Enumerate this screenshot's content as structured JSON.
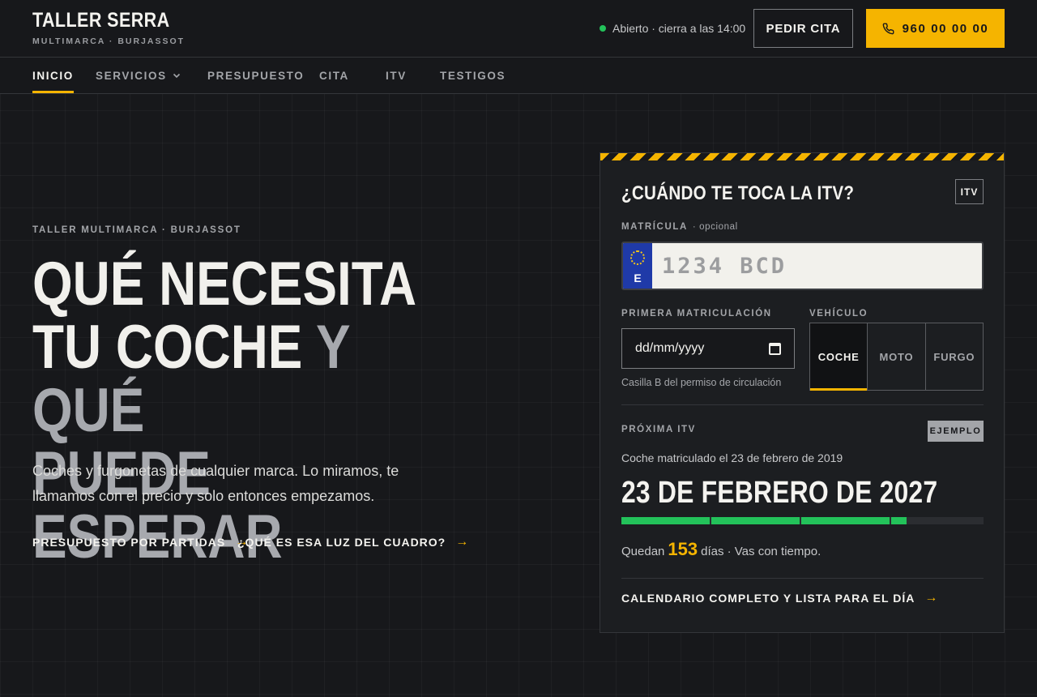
{
  "header": {
    "brand_title": "TALLER SERRA",
    "brand_subtitle": "MULTIMARCA · BURJASSOT",
    "status_text": "Abierto · cierra a las 14:00",
    "status_color": "#23c25a",
    "cita_button": "PEDIR CITA",
    "phone_button": "960 00 00 00",
    "phone_icon": "phone-icon",
    "accent_color": "#f5b400"
  },
  "nav": {
    "items": [
      {
        "label": "INICIO",
        "active": true
      },
      {
        "label": "SERVICIOS",
        "has_dropdown": true
      },
      {
        "label": "PRESUPUESTO"
      },
      {
        "label": "CITA"
      },
      {
        "label": "ITV"
      },
      {
        "label": "TESTIGOS"
      }
    ]
  },
  "hero": {
    "eyebrow": "TALLER MULTIMARCA · BURJASSOT",
    "title_line1": "QUÉ NECESITA",
    "title_line2a": "TU COCHE",
    "title_line2b": "Y QUÉ",
    "title_line3": "PUEDE ESPERAR",
    "lead": "Coches y furgonetas de cualquier marca. Lo miramos, te llamamos con el precio y solo entonces empezamos.",
    "link1": "PRESUPUESTO POR PARTIDAS",
    "link2": "¿QUÉ ES ESA LUZ DEL CUADRO?",
    "arrow": "→"
  },
  "itv_card": {
    "title": "¿CUÁNDO TE TOCA LA ITV?",
    "tag": "ITV",
    "plate_label": "MATRÍCULA",
    "plate_optional": "· opcional",
    "plate_country": "E",
    "plate_placeholder": "1234 BCD",
    "date_label": "PRIMERA MATRICULACIÓN",
    "date_placeholder": "dd/mm/yyyy",
    "date_hint": "Casilla B del permiso de circulación",
    "vehicle_label": "VEHÍCULO",
    "vehicle_options": [
      "COCHE",
      "MOTO",
      "FURGO"
    ],
    "vehicle_selected": "COCHE",
    "next_label": "PRÓXIMA ITV",
    "example_badge": "EJEMPLO",
    "result_sub": "Coche matriculado el 23 de febrero de 2019",
    "result_date": "23 DE FEBRERO DE 2027",
    "progress_fraction": 0.79,
    "remaining_prefix": "Quedan",
    "remaining_days": "153",
    "remaining_suffix": "días · Vas con tiempo.",
    "calendar_link": "CALENDARIO COMPLETO Y LISTA PARA EL DÍA",
    "arrow": "→"
  }
}
